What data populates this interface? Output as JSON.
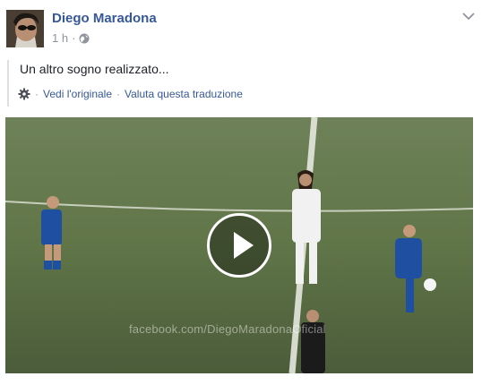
{
  "post": {
    "author": "Diego Maradona",
    "time": "1 h",
    "separator": "·",
    "privacy_icon": "globe-icon",
    "menu_icon": "chevron-down-icon",
    "text": "Un altro sogno realizzato...",
    "translation": {
      "settings_icon": "gear-icon",
      "dot1": "·",
      "see_original": "Vedi l'originale",
      "dot2": "·",
      "rate_translation": "Valuta questa traduzione"
    },
    "video": {
      "watermark": "facebook.com/DiegoMaradonaOficial",
      "play_icon": "play-icon"
    }
  },
  "colors": {
    "link": "#365899",
    "text": "#1d2129",
    "meta": "#90949c"
  }
}
